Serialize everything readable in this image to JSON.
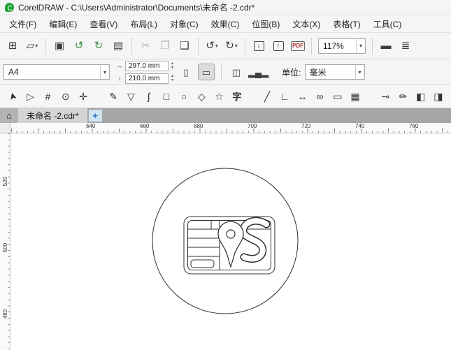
{
  "colors": {
    "logo_green": "#21a038",
    "toolbar_bg": "#f5f5f5",
    "new_tab_bg": "#cfe3f2",
    "new_tab_plus": "#2878be",
    "artwork_stroke": "#2e2e2e"
  },
  "window": {
    "title": "CorelDRAW - C:\\Users\\Administrator\\Documents\\未命名 -2.cdr*"
  },
  "menu": {
    "items": [
      "文件(F)",
      "编辑(E)",
      "查看(V)",
      "布局(L)",
      "对象(C)",
      "效果(C)",
      "位图(B)",
      "文本(X)",
      "表格(T)",
      "工具(C)"
    ]
  },
  "toolbar": {
    "zoom_level": "117%",
    "buttons": [
      {
        "name": "new-document-button",
        "glyph": "⊞"
      },
      {
        "name": "open-button",
        "glyph": "▱",
        "dropdown": true
      },
      {
        "sep": true
      },
      {
        "name": "save-button",
        "glyph": "▣"
      },
      {
        "name": "cloud-open-button",
        "glyph": "↺",
        "color": "#3f8f3f"
      },
      {
        "name": "cloud-save-button",
        "glyph": "↻",
        "color": "#3f8f3f"
      },
      {
        "name": "print-button",
        "glyph": "▤"
      },
      {
        "sep": true
      },
      {
        "name": "cut-button",
        "glyph": "✂",
        "disabled": true
      },
      {
        "name": "copy-button",
        "glyph": "❐",
        "disabled": true
      },
      {
        "name": "paste-button",
        "glyph": "❑"
      },
      {
        "sep": true
      },
      {
        "name": "undo-button",
        "glyph": "↺",
        "dropdown": true
      },
      {
        "name": "redo-button",
        "glyph": "↻",
        "dropdown": true
      },
      {
        "sep": true
      },
      {
        "name": "import-button",
        "glyph": "↓",
        "boxed": true
      },
      {
        "name": "export-button",
        "glyph": "↑",
        "boxed": true
      },
      {
        "name": "publish-pdf-button",
        "glyph": "PDF",
        "pdf": true
      },
      {
        "sep": true
      },
      {
        "zoom": true
      },
      {
        "sep": true
      },
      {
        "name": "fullscreen-preview-button",
        "glyph": "▬"
      },
      {
        "name": "show-rulers-button",
        "glyph": "≣"
      }
    ]
  },
  "property_bar": {
    "page_size": "A4",
    "page_width": "297.0 mm",
    "page_height": "210.0 mm",
    "units_label": "单位:",
    "units_value": "毫米",
    "buttons": [
      {
        "name": "portrait-button",
        "glyph": "▯"
      },
      {
        "name": "landscape-button",
        "glyph": "▭",
        "active": true
      },
      {
        "sep": true
      },
      {
        "name": "apply-current-page-button",
        "glyph": "◫"
      },
      {
        "name": "page-sorter-button",
        "glyph": "▂▄▂"
      }
    ]
  },
  "toolbox": {
    "tools": [
      {
        "name": "pick-tool",
        "glyph": "➤",
        "rot": true
      },
      {
        "name": "shape-tool",
        "glyph": "▷"
      },
      {
        "name": "crop-tool",
        "glyph": "#"
      },
      {
        "name": "zoom-tool",
        "glyph": "⊙"
      },
      {
        "name": "pan-tool",
        "glyph": "✛"
      },
      {
        "sep": true
      },
      {
        "name": "freehand-tool",
        "glyph": "✎"
      },
      {
        "name": "pen-tool",
        "glyph": "▽"
      },
      {
        "name": "bezier-tool",
        "glyph": "∫"
      },
      {
        "name": "rectangle-tool",
        "glyph": "□"
      },
      {
        "name": "ellipse-tool",
        "glyph": "○"
      },
      {
        "name": "polygon-tool",
        "glyph": "◇"
      },
      {
        "name": "common-shapes-tool",
        "glyph": "☆"
      },
      {
        "name": "text-tool",
        "glyph": "字",
        "text": true
      },
      {
        "sep": true
      },
      {
        "name": "straight-line-tool",
        "glyph": "╱"
      },
      {
        "name": "connector-tool",
        "glyph": "∟"
      },
      {
        "name": "dimension-tool",
        "glyph": "↔"
      },
      {
        "name": "lens-tool",
        "glyph": "∞"
      },
      {
        "name": "shadow-tool",
        "glyph": "▭"
      },
      {
        "name": "transparency-tool",
        "glyph": "▦"
      },
      {
        "sep": true
      },
      {
        "name": "eyedropper-tool",
        "glyph": "⊸"
      },
      {
        "name": "outline-pen-tool",
        "glyph": "✏"
      },
      {
        "name": "fill-tool",
        "glyph": "◧"
      },
      {
        "name": "interactive-fill-tool",
        "glyph": "◨"
      }
    ]
  },
  "document_bar": {
    "tab_label": "未命名 -2.cdr*",
    "new_tab_label": "+"
  },
  "rulers": {
    "horizontal": [
      "640",
      "660",
      "680",
      "700",
      "720",
      "740",
      "760"
    ],
    "vertical": [
      "520",
      "500",
      "480"
    ]
  }
}
